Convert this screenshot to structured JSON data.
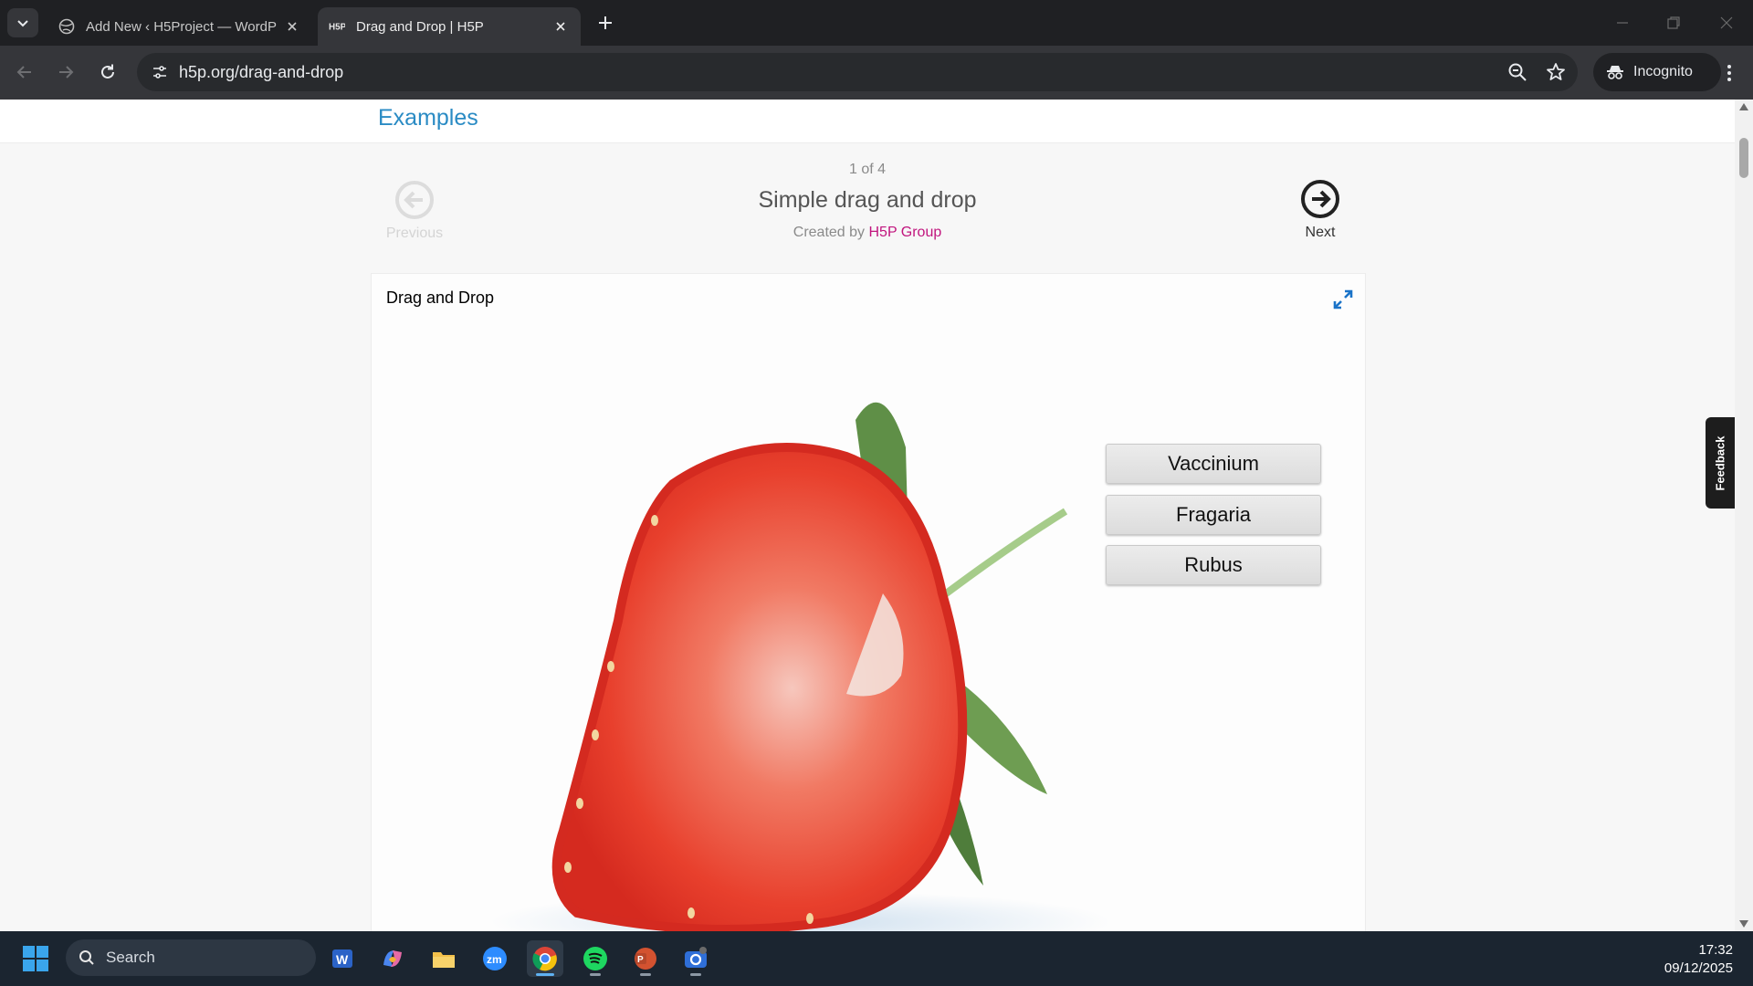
{
  "browser": {
    "tabs": [
      {
        "title": "Add New ‹ H5Project — WordP",
        "active": false
      },
      {
        "title": "Drag and Drop | H5P",
        "active": true
      }
    ],
    "url": "h5p.org/drag-and-drop",
    "incognito_label": "Incognito"
  },
  "page": {
    "section_title": "Examples",
    "counter": "1 of 4",
    "example_title": "Simple drag and drop",
    "created_by_prefix": "Created by",
    "created_by_author": "H5P Group",
    "previous_label": "Previous",
    "next_label": "Next"
  },
  "h5p": {
    "title": "Drag and Drop",
    "draggables": [
      "Vaccinium",
      "Fragaria",
      "Rubus"
    ]
  },
  "feedback_tab": "Feedback",
  "taskbar": {
    "search_placeholder": "Search",
    "time": "17:32",
    "date": "09/12/2025"
  },
  "colors": {
    "link_blue": "#2a8bc4",
    "author_magenta": "#c1157e",
    "strawberry_red": "#e8332a"
  }
}
